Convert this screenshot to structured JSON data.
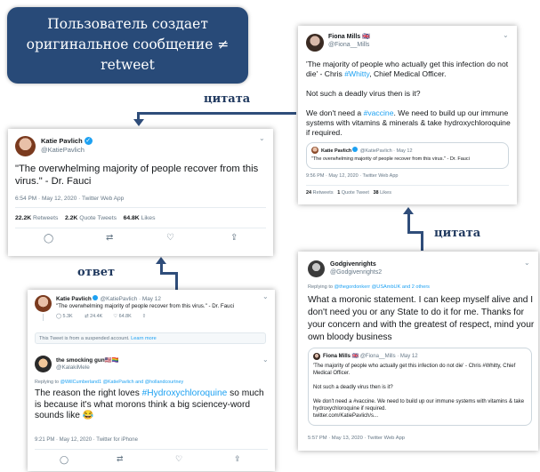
{
  "title_box": {
    "text": "Пользователь создает оригинальное  сообщение ≠ retweet"
  },
  "labels": {
    "quote_top": "цитата",
    "quote_right": "цитата",
    "reply": "ответ"
  },
  "colors": {
    "title_bg": "#284a78",
    "arrow": "#2f4d7a",
    "twitter_blue": "#1da1f2",
    "like_red": "#e0245e"
  },
  "katie_main": {
    "name": "Katie Pavlich",
    "handle": "@KatiePavlich",
    "text": "\"The overwhelming majority of people recover from this virus.\" - Dr. Fauci",
    "timestamp": "6:54 PM · May 12, 2020 · Twitter Web App",
    "retweets_count": "22.2K",
    "retweets_label": "Retweets",
    "quotes_count": "2.2K",
    "quotes_label": "Quote Tweets",
    "likes_count": "64.8K",
    "likes_label": "Likes"
  },
  "fiona": {
    "name": "Fiona Mills 🇬🇧",
    "handle": "@Fiona__Mills",
    "text_before": "'The majority of people who actually get this infection do not die' - Chris ",
    "hashtag_whitty": "#Whitty",
    "text_after": ", Chief Medical Officer.",
    "line2": "Not such a deadly virus then is it?",
    "line3_before": "We don't need a ",
    "hashtag_vaccine": "#vaccine",
    "line3_after": ".  We need to build up our immune systems with vitamins & minerals & take hydroxychloroquine if required.",
    "quoted_name": "Katie Pavlich",
    "quoted_handle": "@KatiePavlich · May 12",
    "quoted_text": "\"The overwhelming majority of people recover from this virus.\" - Dr. Fauci",
    "timestamp": "9:56 PM · May 12, 2020 · Twitter Web App",
    "retweets_count": "24",
    "retweets_label": "Retweets",
    "quotes_count": "1",
    "quotes_label": "Quote Tweet",
    "likes_count": "38",
    "likes_label": "Likes"
  },
  "godgiven": {
    "name": "Godgivenrights",
    "handle": "@Godgivenrights2",
    "replying_prefix": "Replying to ",
    "replying_users": "@thegordonkerr @USAmbUK and 2 others",
    "text": "What a moronic statement. I can keep myself alive and I don't need you or any State to do it for me. Thanks for your concern and with the greatest of respect, mind your own bloody business",
    "quoted_name": "Fiona Mills 🇬🇧",
    "quoted_handle": "@Fiona__Mills · May 12",
    "quoted_line1": "'The majority of people who actually get this infection do not die' - Chris #Whitty, Chief Medical Officer.",
    "quoted_line2": "Not such a deadly virus then is it?",
    "quoted_line3": "We don't need a #vaccine.  We need to build up our immune systems with vitamins & take hydroxychloroquine if required.",
    "quoted_link": "twitter.com/KatiePavlich/s...",
    "timestamp": "5:57 PM · May 13, 2020 · Twitter Web App"
  },
  "reply_thread": {
    "parent_name": "Katie Pavlich",
    "parent_handle": "@KatiePavlich · May 12",
    "parent_text": "\"The overwhelming majority of people recover from this virus.\" - Dr. Fauci",
    "parent_replies": "5.3K",
    "parent_retweets": "24.4K",
    "parent_likes": "64.8K",
    "suspended_text": "This Tweet is from a suspended account. ",
    "learn_more": "Learn more",
    "reply_name": "the smocking gun🇺🇸🏳️‍🌈",
    "reply_handle": "@KalakiMele",
    "replying_prefix": "Replying to ",
    "replying_users": "@WillCumberland1 @KatiePavlich and @hollandcourtney",
    "reply_text_before": "The reason the right loves ",
    "reply_hashtag": "#Hydroxychloroquine",
    "reply_text_after": " so much is because it's what morons think a big sciencey-word sounds like 😂",
    "timestamp": "9:21 PM · May 12, 2020 · Twitter for iPhone"
  }
}
